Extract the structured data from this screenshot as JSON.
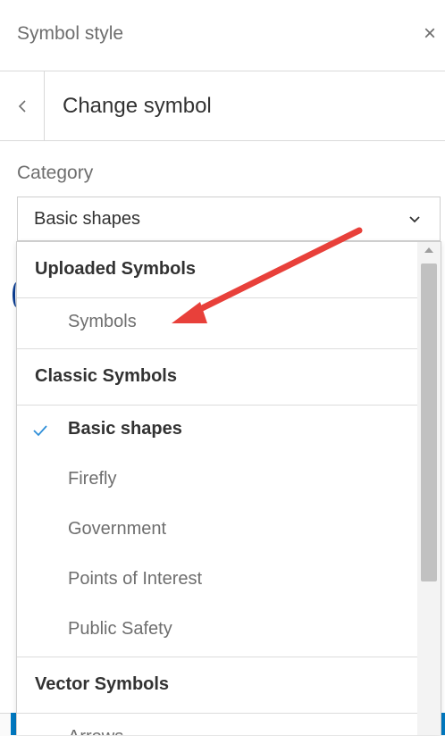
{
  "panel": {
    "title": "Symbol style",
    "close_symbol": "×"
  },
  "subheader": {
    "title": "Change symbol"
  },
  "category": {
    "label": "Category",
    "selected_value": "Basic shapes"
  },
  "dropdown": {
    "groups": [
      {
        "heading": "Uploaded Symbols",
        "options": [
          "Symbols"
        ]
      },
      {
        "heading": "Classic Symbols",
        "options": [
          "Basic shapes",
          "Firefly",
          "Government",
          "Points of Interest",
          "Public Safety"
        ]
      },
      {
        "heading": "Vector Symbols",
        "options": [
          "Arrows"
        ]
      }
    ],
    "selected_option": "Basic shapes"
  },
  "annotation": {
    "arrow_color": "#e8403a"
  },
  "colors": {
    "accent": "#0079c1",
    "check": "#2f8fd8"
  }
}
